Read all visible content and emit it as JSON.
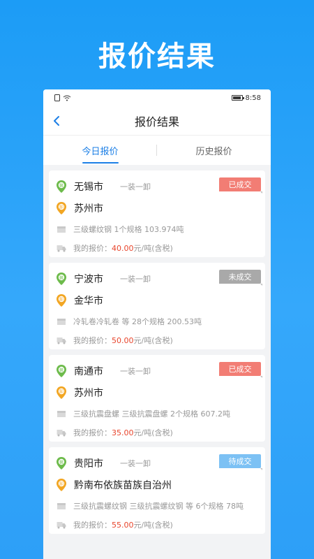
{
  "hero": {
    "title": "报价结果"
  },
  "status": {
    "time": "8:58"
  },
  "nav": {
    "title": "报价结果"
  },
  "tabs": [
    {
      "label": "今日报价",
      "active": true
    },
    {
      "label": "历史报价",
      "active": false
    }
  ],
  "price_prefix": "我的报价：",
  "price_suffix": "元/吨(含税)",
  "cards": [
    {
      "origin": "无锡市",
      "load_type": "一装一卸",
      "destination": "苏州市",
      "goods": "三级螺纹钢  1个规格 103.974吨",
      "price": "40.00",
      "status": "已成交",
      "status_color": "#f27d74"
    },
    {
      "origin": "宁波市",
      "load_type": "一装一卸",
      "destination": "金华市",
      "goods": "冷轧卷冷轧卷 等 28个规格 200.53吨",
      "price": "50.00",
      "status": "未成交",
      "status_color": "#a9a9a9"
    },
    {
      "origin": "南通市",
      "load_type": "一装一卸",
      "destination": "苏州市",
      "goods": "三级抗震盘螺 三级抗震盘螺  2个规格 607.2吨",
      "price": "35.00",
      "status": "已成交",
      "status_color": "#f27d74"
    },
    {
      "origin": "贵阳市",
      "load_type": "一装一卸",
      "destination": "黔南布依族苗族自治州",
      "goods": "三级抗震螺纹钢 三级抗震螺纹钢 等 6个规格 78吨",
      "price": "55.00",
      "status": "待成交",
      "status_color": "#7cc1f4"
    }
  ],
  "colors": {
    "brand": "#1c7fe6",
    "price": "#e8452c",
    "pin_origin": "#6dbb4b",
    "pin_dest": "#f2a623"
  },
  "icons": {
    "back": "chevron-left-icon",
    "origin": "green-pin-icon",
    "destination": "orange-pin-icon",
    "goods": "box-icon",
    "price": "truck-icon"
  }
}
